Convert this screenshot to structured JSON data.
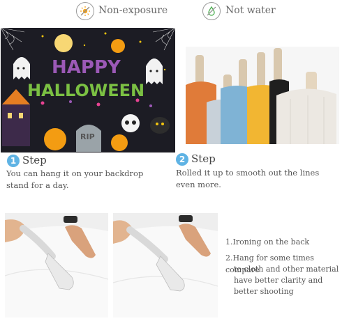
{
  "badges": [
    {
      "label": "Non-exposure",
      "icon": "sun-crossed-icon",
      "color": "#f5a623"
    },
    {
      "label": "Not water",
      "icon": "water-drop-icon",
      "color": "#4caf50"
    }
  ],
  "halloween": {
    "word1": "HAPPY",
    "word2": "HALLOWEEN",
    "rip": "RIP",
    "colors": {
      "sky": "#1c1c24",
      "orange": "#f39c12",
      "purple": "#9b59b6",
      "green": "#7bc043",
      "pink": "#e84393"
    }
  },
  "steps": [
    {
      "num": "1",
      "title": "Step",
      "text_line1": "You can hang it on your backdrop",
      "text_line2": "stand for a day."
    },
    {
      "num": "2",
      "title": "Step",
      "text_line1": "Rolled it up to smooth out the lines",
      "text_line2": "even more."
    }
  ],
  "notes": {
    "n1": "1.Ironing on the back",
    "n2_l1": "2.Hang for some times compare",
    "n2_l2": "to cloth and other material",
    "n2_l3": "have better clarity and",
    "n2_l4": "better shooting"
  }
}
